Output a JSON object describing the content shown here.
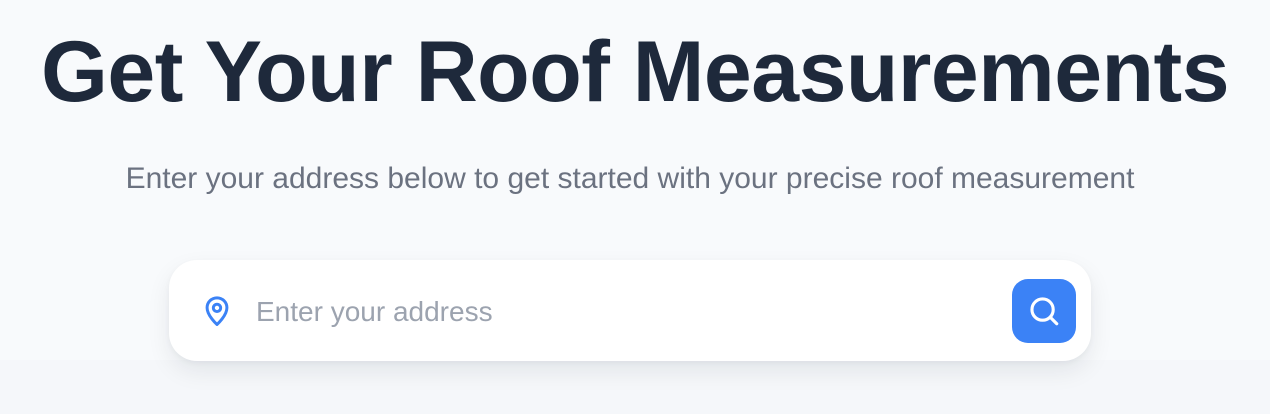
{
  "hero": {
    "title": "Get Your Roof Measurements",
    "subtitle": "Enter your address below to get started with your precise roof measurement"
  },
  "search": {
    "placeholder": "Enter your address",
    "value": "",
    "pin_icon": "map-pin-icon",
    "button_icon": "search-icon"
  },
  "colors": {
    "accent": "#3b82f6",
    "title": "#1e293b",
    "subtitle": "#6b7280",
    "placeholder": "#9ca3af",
    "background": "#f8fafc"
  }
}
